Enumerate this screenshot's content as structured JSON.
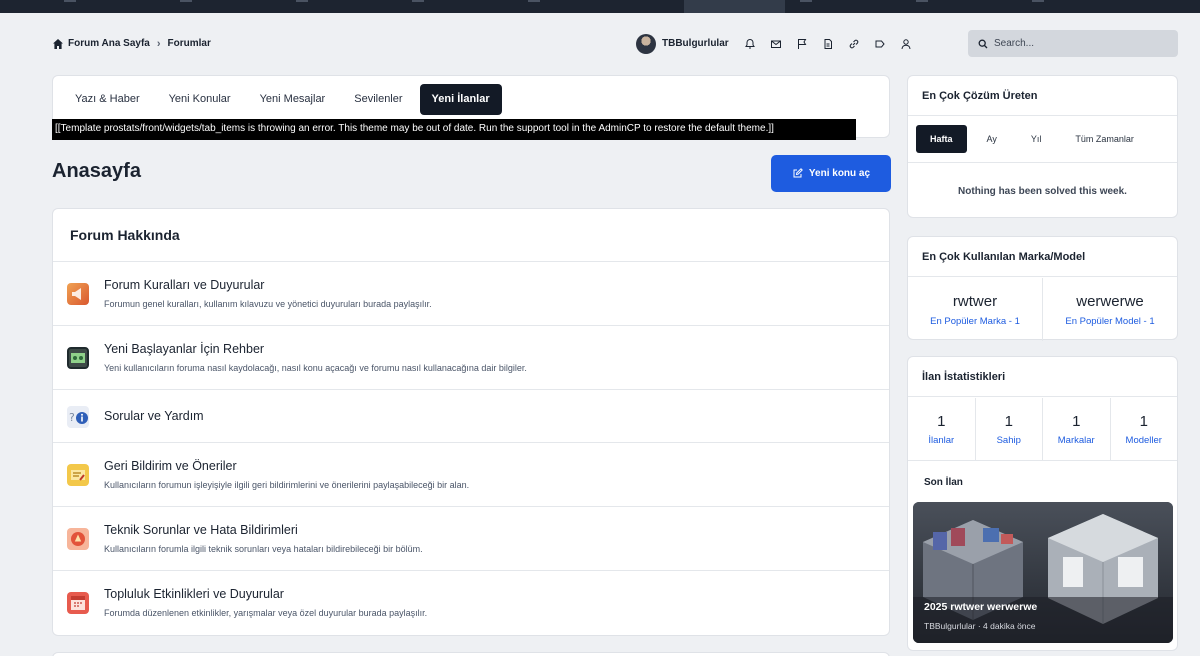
{
  "breadcrumb": {
    "home": "Forum Ana Sayfa",
    "current": "Forumlar"
  },
  "user": {
    "name": "TBBulgurlular"
  },
  "search": {
    "placeholder": "Search..."
  },
  "tabs": [
    "Yazı & Haber",
    "Yeni Konular",
    "Yeni Mesajlar",
    "Sevilenler",
    "Yeni İlanlar"
  ],
  "template_error": "[[Template prostats/front/widgets/tab_items is throwing an error. This theme may be out of date. Run the support tool in the AdminCP to restore the default theme.]]",
  "page": {
    "title": "Anasayfa",
    "new_topic_label": "Yeni konu aç"
  },
  "forum": {
    "heading": "Forum Hakkında",
    "items": [
      {
        "title": "Forum Kuralları ve Duyurular",
        "desc": "Forumun genel kuralları, kullanım kılavuzu ve yönetici duyuruları burada paylaşılır.",
        "icon": "megaphone-icon"
      },
      {
        "title": "Yeni Başlayanlar İçin Rehber",
        "desc": "Yeni kullanıcıların foruma nasıl kaydolacağı, nasıl konu açacağı ve forumu nasıl kullanacağına dair bilgiler.",
        "icon": "guide-icon"
      },
      {
        "title": "Sorular ve Yardım",
        "desc": "",
        "icon": "question-info-icon"
      },
      {
        "title": "Geri Bildirim ve Öneriler",
        "desc": "Kullanıcıların forumun işleyişiyle ilgili geri bildirimlerini ve önerilerini paylaşabileceği bir alan.",
        "icon": "feedback-icon"
      },
      {
        "title": "Teknik Sorunlar ve Hata Bildirimleri",
        "desc": "Kullanıcıların forumla ilgili teknik sorunları veya hataları bildirebileceği bir bölüm.",
        "icon": "alert-icon"
      },
      {
        "title": "Topluluk Etkinlikleri ve Duyurular",
        "desc": "Forumda düzenlenen etkinlikler, yarışmalar veya özel duyurular burada paylaşılır.",
        "icon": "calendar-icon"
      }
    ]
  },
  "solutions": {
    "heading": "En Çok Çözüm Üreten",
    "periods": [
      "Hafta",
      "Ay",
      "Yıl",
      "Tüm Zamanlar"
    ],
    "empty": "Nothing has been solved this week."
  },
  "brands": {
    "heading": "En Çok Kullanılan Marka/Model",
    "items": [
      {
        "name": "rwtwer",
        "sub": "En Popüler Marka - 1"
      },
      {
        "name": "werwerwe",
        "sub": "En Popüler Model - 1"
      }
    ]
  },
  "stats": {
    "heading": "İlan İstatistikleri",
    "items": [
      {
        "value": "1",
        "label": "İlanlar"
      },
      {
        "value": "1",
        "label": "Sahip"
      },
      {
        "value": "1",
        "label": "Markalar"
      },
      {
        "value": "1",
        "label": "Modeller"
      }
    ],
    "latest_label": "Son İlan",
    "latest": {
      "title": "2025 rwtwer werwerwe",
      "meta": "TBBulgurlular · 4 dakika önce"
    }
  },
  "colors": {
    "accent": "#1e5ce0",
    "dark": "#131a26",
    "background": "#eef0f3"
  }
}
